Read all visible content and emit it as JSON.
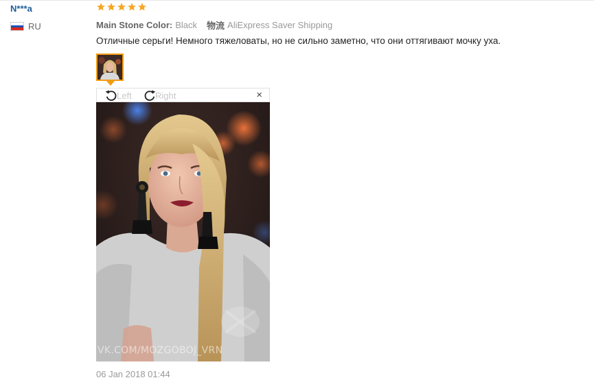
{
  "user": {
    "name": "N***a",
    "country_code": "RU",
    "flag_colors": [
      "#ffffff",
      "#1c4fb8",
      "#d52b1e"
    ]
  },
  "review": {
    "rating": 5,
    "star_color": "#f5a623",
    "attributes": [
      {
        "key": "Main Stone Color:",
        "value": "Black"
      },
      {
        "key": "物流",
        "value": "AliExpress Saver Shipping"
      }
    ],
    "text": "Отличные серьги! Немного тяжеловаты, но не сильно заметно, что они оттягивают мочку уха.",
    "date": "06 Jan 2018 01:44"
  },
  "viewer": {
    "rotate_left_label": "Left",
    "rotate_right_label": "Right",
    "close_symbol": "×",
    "accent_color": "#f39c12",
    "watermark": "VK.COM/MOZGOBOJ_VRN"
  }
}
